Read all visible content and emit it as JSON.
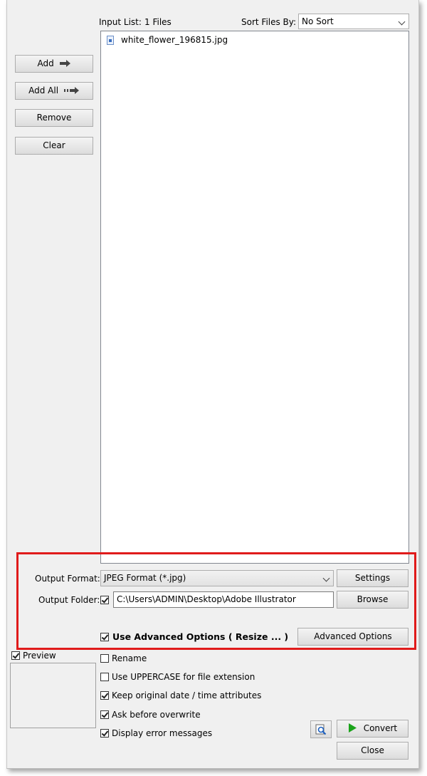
{
  "input_list": {
    "label": "Input List:",
    "count": "1 Files",
    "files": [
      "white_flower_196815.jpg"
    ]
  },
  "sort": {
    "label": "Sort Files By:",
    "value": "No Sort"
  },
  "left_buttons": {
    "add": "Add",
    "add_all": "Add All",
    "remove": "Remove",
    "clear": "Clear"
  },
  "output_format": {
    "label": "Output Format:",
    "value": "JPEG Format (*.jpg)",
    "settings": "Settings"
  },
  "output_folder": {
    "label": "Output Folder:",
    "value": "C:\\Users\\ADMIN\\Desktop\\Adobe Illustrator",
    "browse": "Browse"
  },
  "advanced": {
    "label": "Use Advanced Options ( Resize ... )",
    "button": "Advanced Options"
  },
  "preview": {
    "label": "Preview"
  },
  "options": [
    {
      "label": "Rename",
      "checked": false
    },
    {
      "label": "Use UPPERCASE for file extension",
      "checked": false
    },
    {
      "label": "Keep original date / time attributes",
      "checked": true
    },
    {
      "label": "Ask before overwrite",
      "checked": true
    },
    {
      "label": "Display error messages",
      "checked": true
    }
  ],
  "actions": {
    "convert": "Convert",
    "close": "Close"
  },
  "colors": {
    "highlight_border": "#e01b1b",
    "convert_icon": "#1aa31a"
  },
  "icons": [
    "right-arrow-icon",
    "double-right-arrow-icon",
    "file-image-icon",
    "magnifier-icon",
    "play-icon",
    "chevron-down-icon",
    "checkbox-icon"
  ]
}
